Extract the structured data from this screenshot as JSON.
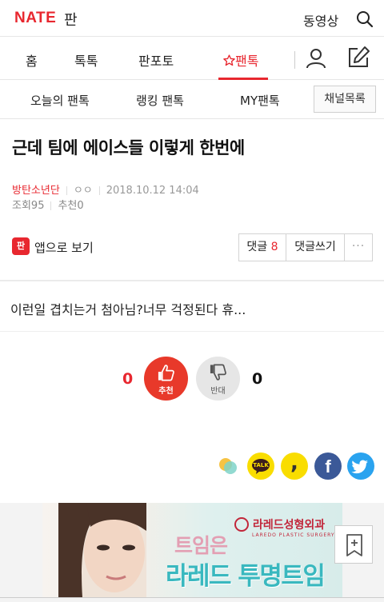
{
  "header": {
    "logo": "NATE",
    "logo_sub": "판",
    "video_link": "동영상"
  },
  "nav": {
    "items": [
      {
        "label": "홈"
      },
      {
        "label": "톡톡"
      },
      {
        "label": "판포토"
      },
      {
        "label": "팬톡",
        "active": true
      }
    ],
    "active_color": "#e8272f"
  },
  "subnav": {
    "items": [
      {
        "label": "오늘의 팬톡"
      },
      {
        "label": "랭킹 팬톡"
      },
      {
        "label": "MY팬톡"
      }
    ],
    "channel_button": "채널목록"
  },
  "post": {
    "title": "근데 팀에 에이스들 이렇게 한번에",
    "author": "방탄소년단",
    "nickname": "ㅇㅇ",
    "date": "2018.10.12 14:04",
    "views_label": "조회",
    "views": "95",
    "recommend_label": "추천",
    "recommends": "0",
    "body": "이런일 겹치는거 첨아님?너무 걱정된다 휴..."
  },
  "actions": {
    "app_icon_text": "판",
    "app_view": "앱으로 보기",
    "comment_label": "댓글",
    "comment_count": "8",
    "write_comment": "댓글쓰기",
    "more": "···"
  },
  "vote": {
    "like_count": "0",
    "like_label": "추천",
    "dislike_count": "0",
    "dislike_label": "반대"
  },
  "share": {
    "kakaotalk": "TALK",
    "band": ",",
    "facebook": "f",
    "icons": [
      "kakaostory-icon",
      "kakaotalk-icon",
      "band-icon",
      "facebook-icon",
      "twitter-icon"
    ]
  },
  "ad": {
    "brand": "라레드성형외과",
    "brand_sub": "LAREDO PLASTIC SURGERY",
    "line1": "트임은",
    "line2": "라레드 투명트임",
    "info": "!"
  }
}
